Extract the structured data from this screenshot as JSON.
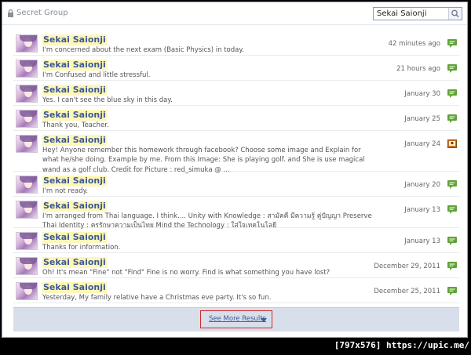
{
  "header": {
    "group_name": "Secret Group",
    "search_value": "Sekai Saionji"
  },
  "results": [
    {
      "name": "Sekai Saionji",
      "text": "I'm concerned about the next exam (Basic Physics) in today.",
      "time": "42 minutes ago",
      "icon": "comment-icon"
    },
    {
      "name": "Sekai Saionji",
      "text": "I'm Confused and little stressful.",
      "time": "21 hours ago",
      "icon": "comment-icon"
    },
    {
      "name": "Sekai Saionji",
      "text": "Yes. I can't see the blue sky in this day.",
      "time": "January 30",
      "icon": "comment-icon"
    },
    {
      "name": "Sekai Saionji",
      "text": "Thank you, Teacher.",
      "time": "January 25",
      "icon": "comment-icon"
    },
    {
      "name": "Sekai Saionji",
      "text": "Hey! Anyone remember this homework through facebook? Choose some image and Explain for what he/she doing. Example by me. From this Image: She is playing golf. and She is use magical wand as a golf club. Credit for Picture : red_simuka @ ...",
      "time": "January 24",
      "icon": "photo-icon"
    },
    {
      "name": "Sekai Saionji",
      "text": "I'm not ready.",
      "time": "January 20",
      "icon": "comment-icon"
    },
    {
      "name": "Sekai Saionji",
      "text": "I'm arranged from Thai language. I think.... Unity with Knowledge : สามัคคี มีความรู้ คู่ปัญญา Preserve Thai Identity : ครรักษาความเป็นไทย Mind the Technology : ใส่ใจเทคโนโลยี",
      "time": "January 13",
      "icon": "comment-icon"
    },
    {
      "name": "Sekai Saionji",
      "text": "Thanks for information.",
      "time": "January 13",
      "icon": "comment-icon"
    },
    {
      "name": "Sekai Saionji",
      "text": "Oh! It's mean \"Fine\" not \"Find\" Fine is no worry. Find is what something you have lost?",
      "time": "December 29, 2011",
      "icon": "comment-icon"
    },
    {
      "name": "Sekai Saionji",
      "text": "Yesterday, My family relative have a Christmas eve party. It's so fun.",
      "time": "December 25, 2011",
      "icon": "comment-icon"
    }
  ],
  "see_more": {
    "label": "See More Results"
  },
  "watermark": "[797x576] https://upic.me/",
  "colors": {
    "link": "#3b5998",
    "highlight": "#fff7b8",
    "comment_icon": "#5fa336",
    "photo_icon": "#c9731f",
    "see_more_bar": "#d8dfea",
    "see_more_border": "#cc2a2a"
  }
}
